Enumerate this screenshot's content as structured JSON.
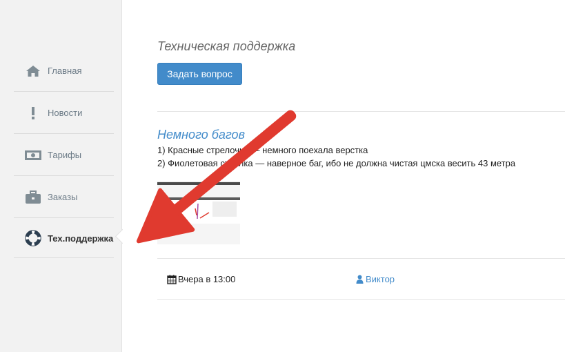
{
  "sidebar": {
    "items": [
      {
        "label": "Главная",
        "icon": "home-icon"
      },
      {
        "label": "Новости",
        "icon": "exclamation-icon"
      },
      {
        "label": "Тарифы",
        "icon": "money-icon"
      },
      {
        "label": "Заказы",
        "icon": "briefcase-icon"
      },
      {
        "label": "Тех.поддержка",
        "icon": "lifebuoy-icon",
        "active": true
      }
    ]
  },
  "main": {
    "title": "Техническая поддержка",
    "ask_button": "Задать вопрос",
    "ticket": {
      "title": "Немного багов",
      "lines": [
        "1) Красные стрелочки — немного поехала верстка",
        "2) Фиолетовая стрелка — наверное баг, ибо не должна чистая цмска весить 43 метра"
      ],
      "date": "Вчера в 13:00",
      "author": "Виктор"
    }
  },
  "colors": {
    "accent": "#428bca",
    "annotation_arrow": "#e03a2f"
  }
}
